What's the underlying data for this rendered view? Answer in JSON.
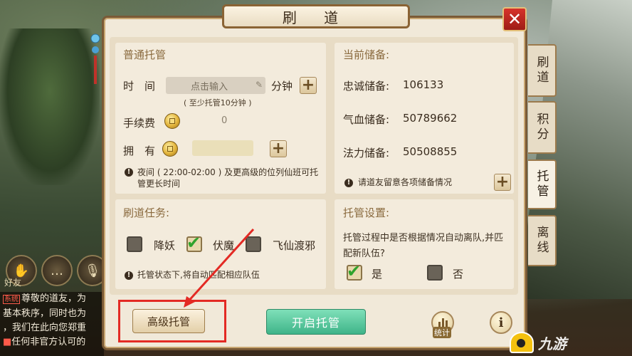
{
  "dialog": {
    "title": "刷 道",
    "close_label": "✕"
  },
  "side_tabs": [
    {
      "label": "刷道"
    },
    {
      "label": "积分"
    },
    {
      "label": "托管"
    },
    {
      "label": "离线"
    }
  ],
  "managed": {
    "title": "普通托管",
    "time_label": "时　间",
    "time_placeholder": "点击输入",
    "unit": "分钟",
    "min_note": "( 至少托管10分钟 )",
    "fee_label": "手续费",
    "fee_value": "0",
    "owned_label": "拥　有",
    "night_note": "夜间 ( 22:00-02:00 ) 及更高级的位列仙班可托管更长时间"
  },
  "reserves": {
    "title": "当前储备:",
    "loyalty_label": "忠诚储备:",
    "loyalty_value": "106133",
    "hp_label": "气血储备:",
    "hp_value": "50789662",
    "mp_label": "法力储备:",
    "mp_value": "50508855",
    "note": "请道友留意各项储备情况"
  },
  "tasks": {
    "title": "刷道任务:",
    "items": [
      {
        "label": "降妖",
        "checked": false
      },
      {
        "label": "伏魔",
        "checked": true
      },
      {
        "label": "飞仙渡邪",
        "checked": false
      }
    ],
    "note": "托管状态下,将自动匹配相应队伍"
  },
  "settings": {
    "title": "托管设置:",
    "question": "托管过程中是否根据情况自动离队,并匹配新队伍?",
    "yes_label": "是",
    "yes_checked": true,
    "no_label": "否",
    "no_checked": false
  },
  "footer": {
    "advanced_label": "高级托管",
    "start_label": "开启托管",
    "stats_label": "统计",
    "info_label": "i"
  },
  "chat": {
    "friend_label": "好友",
    "sys_tag": "系统",
    "lines": [
      "尊敬的道友，为",
      "基本秩序，同时也为",
      "，我们在此向您郑重",
      "任何非官方认可的"
    ]
  },
  "watermark": {
    "text": "九游"
  }
}
